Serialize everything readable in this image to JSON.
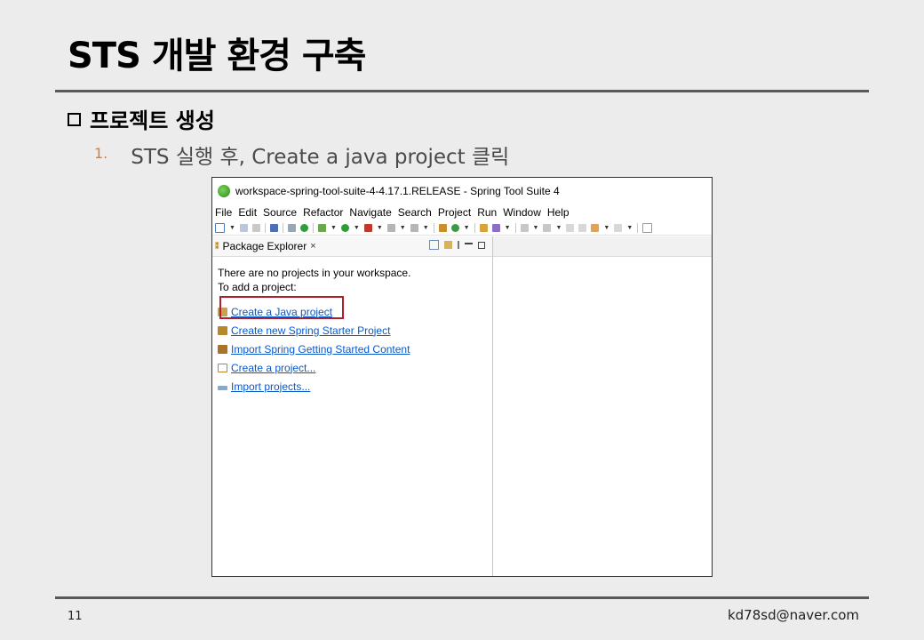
{
  "slide": {
    "title": "STS 개발 환경 구축",
    "section": "프로젝트 생성",
    "step_number": "1.",
    "step_text": "STS 실행 후, Create a java project 클릭",
    "page_number": "11",
    "email": "kd78sd@naver.com"
  },
  "window": {
    "title": "workspace-spring-tool-suite-4-4.17.1.RELEASE - Spring Tool Suite 4",
    "menu": [
      "File",
      "Edit",
      "Source",
      "Refactor",
      "Navigate",
      "Search",
      "Project",
      "Run",
      "Window",
      "Help"
    ],
    "package_explorer": {
      "tab_label": "Package Explorer",
      "close_glyph": "×",
      "message_line1": "There are no projects in your workspace.",
      "message_line2": "To add a project:",
      "links": [
        {
          "label": "Create a Java project",
          "icon": "java-project-icon"
        },
        {
          "label": "Create new Spring Starter Project",
          "icon": "spring-starter-icon"
        },
        {
          "label": "Import Spring Getting Started Content",
          "icon": "import-spring-icon"
        },
        {
          "label": "Create a project...",
          "icon": "new-project-icon"
        },
        {
          "label": "Import projects...",
          "icon": "import-projects-icon"
        }
      ]
    }
  },
  "colors": {
    "accent_number": "#e07a3a",
    "link": "#0a59c9",
    "highlight_border": "#b0202a"
  }
}
